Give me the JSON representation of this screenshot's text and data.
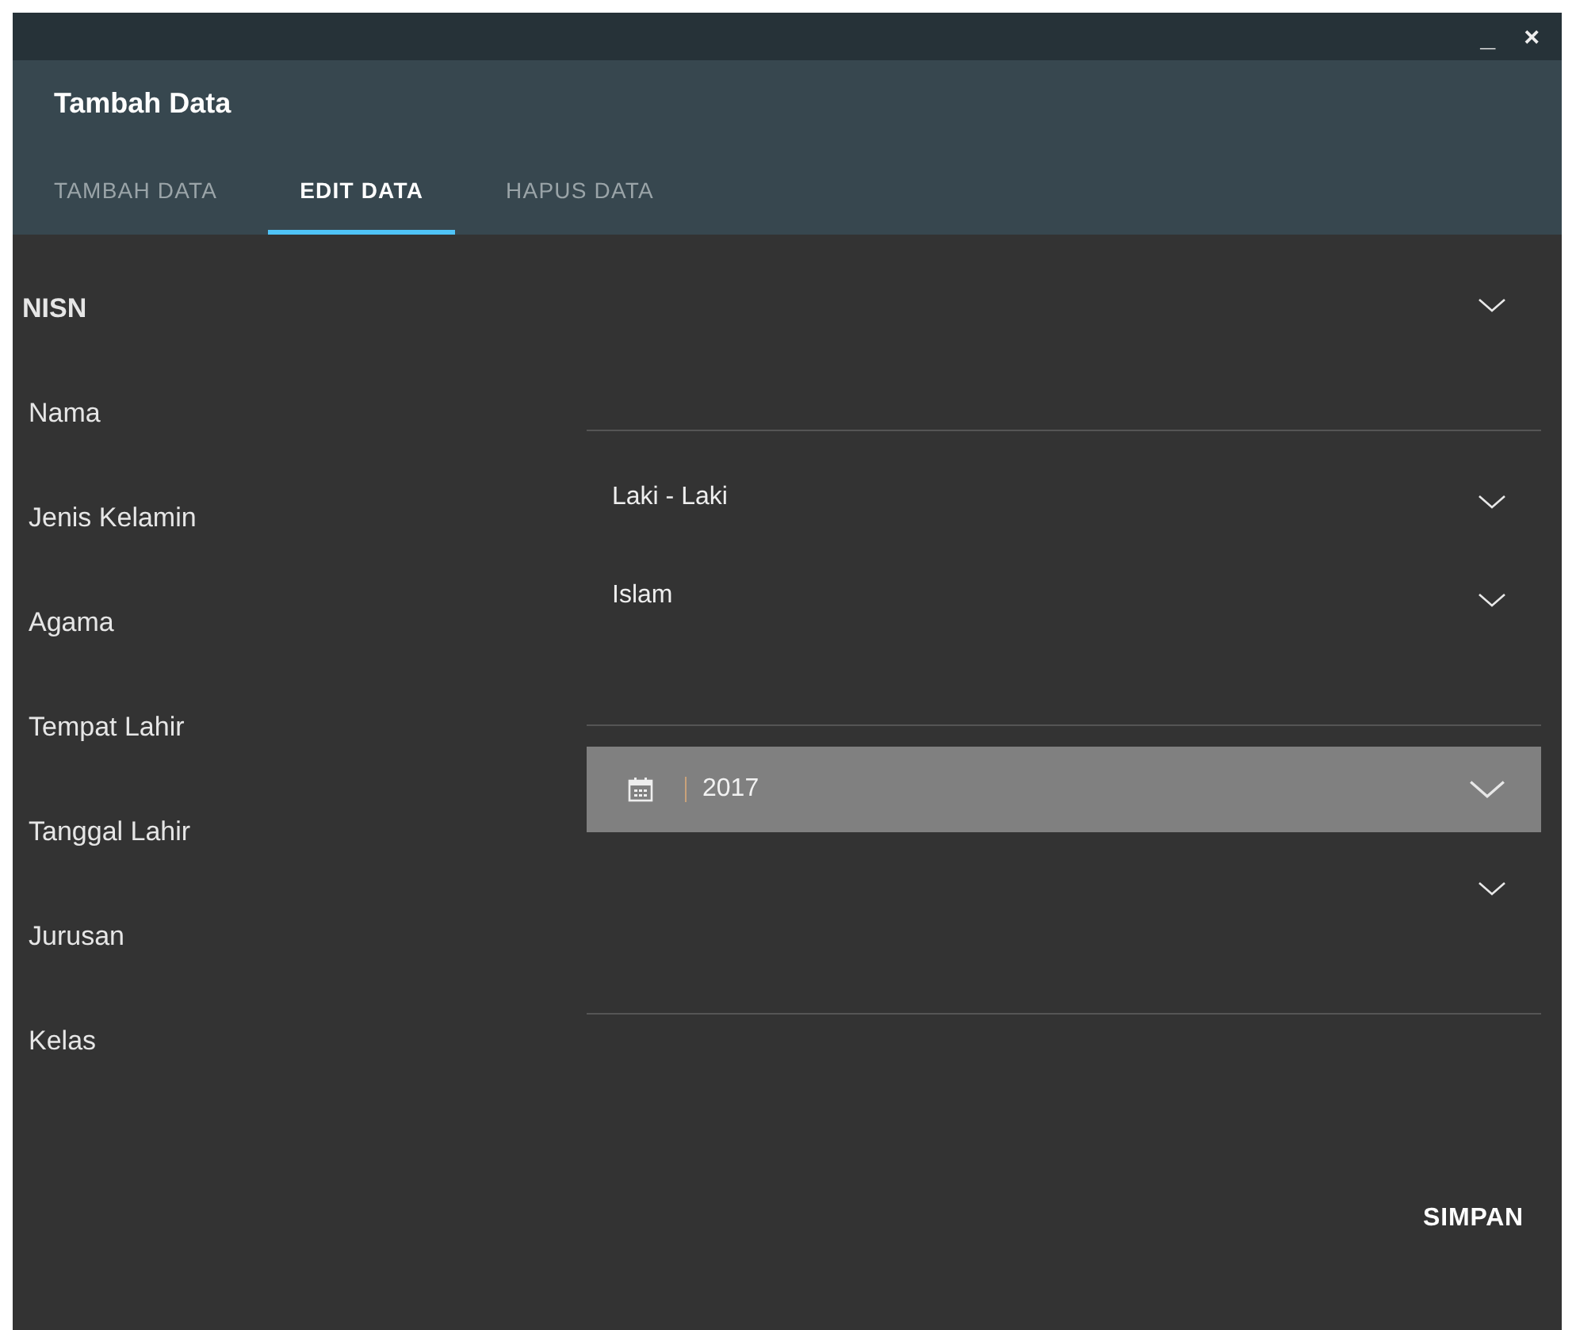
{
  "window": {
    "title": "Tambah Data",
    "controls": [
      "_",
      "×"
    ]
  },
  "tabs": [
    {
      "label": "TAMBAH DATA",
      "selected": false
    },
    {
      "label": "EDIT DATA",
      "selected": true
    },
    {
      "label": "HAPUS DATA",
      "selected": false
    }
  ],
  "labels": [
    "NISN",
    "Nama",
    "Jenis Kelamin",
    "Agama",
    "Tempat Lahir",
    "Tanggal Lahir",
    "Jurusan",
    "Kelas"
  ],
  "fields": [
    {
      "kind": "combo"
    },
    {
      "kind": "text"
    },
    {
      "kind": "combo",
      "value": "Laki - Laki"
    },
    {
      "kind": "combo",
      "value": "Islam"
    },
    {
      "kind": "text"
    },
    {
      "kind": "date",
      "value": "2017",
      "focused": true
    },
    {
      "kind": "combo"
    },
    {
      "kind": "text"
    }
  ],
  "buttons": [
    "SIMPAN"
  ]
}
